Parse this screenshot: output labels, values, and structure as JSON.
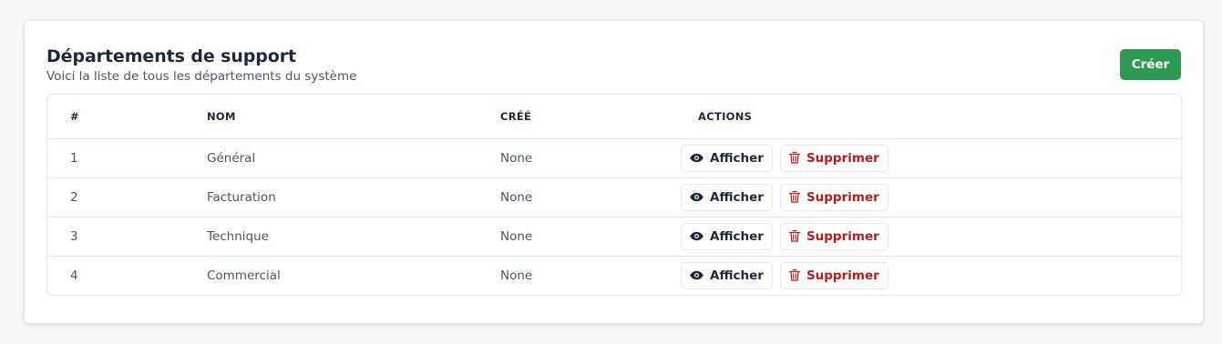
{
  "header": {
    "title": "Départements de support",
    "subtitle": "Voici la liste de tous les départements du système",
    "create_label": "Créer"
  },
  "table": {
    "columns": [
      "#",
      "NOM",
      "CRÉÉ",
      "ACTIONS"
    ],
    "rows": [
      {
        "id": "1",
        "name": "Général",
        "created": "None"
      },
      {
        "id": "2",
        "name": "Facturation",
        "created": "None"
      },
      {
        "id": "3",
        "name": "Technique",
        "created": "None"
      },
      {
        "id": "4",
        "name": "Commercial",
        "created": "None"
      }
    ],
    "view_label": "Afficher",
    "delete_label": "Supprimer"
  },
  "icons": {
    "view": "eye-icon",
    "delete": "trash-icon"
  },
  "colors": {
    "primary": "#2f9a52",
    "danger": "#b91c1c"
  }
}
